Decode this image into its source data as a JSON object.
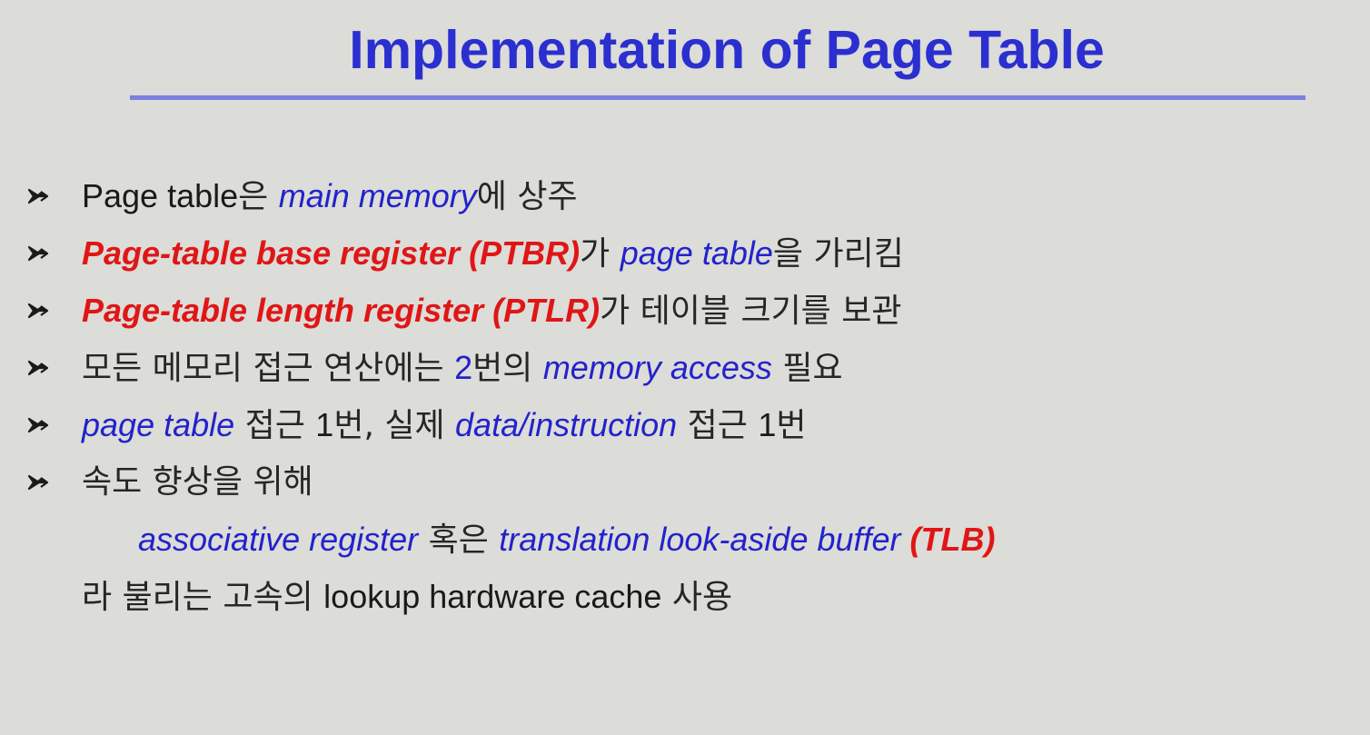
{
  "slide": {
    "title": "Implementation of Page Table",
    "title_color": "#2b2fd0",
    "accent_red": "#e01616",
    "accent_blue": "#2222cc"
  },
  "bullets": [
    {
      "icon": "arrow-bullet-icon",
      "segments": [
        {
          "text": "Page table",
          "style": "black-en"
        },
        {
          "text": "은 ",
          "style": "ko"
        },
        {
          "text": "main memory",
          "style": "blue-it"
        },
        {
          "text": "에 상주",
          "style": "ko"
        }
      ]
    },
    {
      "icon": "arrow-bullet-icon",
      "segments": [
        {
          "text": "Page-table base register (PTBR)",
          "style": "red-bi"
        },
        {
          "text": "가 ",
          "style": "ko"
        },
        {
          "text": "page table",
          "style": "blue-it"
        },
        {
          "text": "을 가리킴",
          "style": "ko"
        }
      ]
    },
    {
      "icon": "arrow-bullet-icon",
      "segments": [
        {
          "text": "Page-table length register (PTLR)",
          "style": "red-bi"
        },
        {
          "text": "가 테이블 크기를 보관",
          "style": "ko"
        }
      ]
    },
    {
      "icon": "arrow-bullet-icon",
      "segments": [
        {
          "text": "모든 메모리 접근 연산에는 ",
          "style": "ko"
        },
        {
          "text": "2",
          "style": "blue-num"
        },
        {
          "text": "번의 ",
          "style": "ko"
        },
        {
          "text": "memory access",
          "style": "blue-it"
        },
        {
          "text": " 필요",
          "style": "ko"
        }
      ]
    },
    {
      "icon": "arrow-bullet-icon",
      "segments": [
        {
          "text": "page table",
          "style": "blue-it"
        },
        {
          "text": " 접근 ",
          "style": "ko"
        },
        {
          "text": "1",
          "style": "black-en"
        },
        {
          "text": "번, 실제 ",
          "style": "ko"
        },
        {
          "text": "data/instruction",
          "style": "blue-it"
        },
        {
          "text": " 접근 ",
          "style": "ko"
        },
        {
          "text": "1",
          "style": "black-en"
        },
        {
          "text": "번",
          "style": "ko"
        }
      ]
    },
    {
      "icon": "arrow-bullet-icon",
      "segments": [
        {
          "text": "속도 향상을 위해",
          "style": "ko"
        }
      ]
    }
  ],
  "continuation": [
    {
      "indent": true,
      "segments": [
        {
          "text": "associative register",
          "style": "blue-it"
        },
        {
          "text": " 혹은 ",
          "style": "ko"
        },
        {
          "text": "translation look-aside buffer ",
          "style": "blue-it"
        },
        {
          "text": "(TLB)",
          "style": "red-bi"
        }
      ]
    },
    {
      "indent": false,
      "segments": [
        {
          "text": "라 불리는 고속의 ",
          "style": "ko"
        },
        {
          "text": "lookup hardware cache",
          "style": "black-en"
        },
        {
          "text": " 사용",
          "style": "ko"
        }
      ]
    }
  ]
}
